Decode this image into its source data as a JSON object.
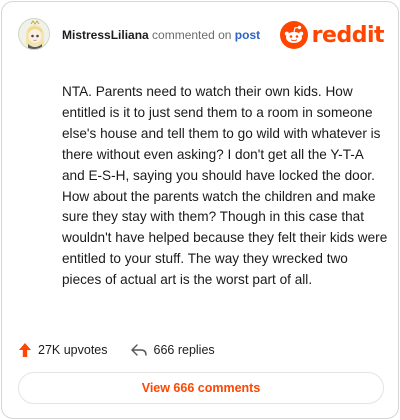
{
  "header": {
    "username": "MistressLiliana",
    "action_text": "commented on",
    "post_link": "post",
    "brand_name": "reddit",
    "icons": {
      "avatar": "anime-avatar-icon",
      "brand": "reddit-snoo-icon"
    }
  },
  "comment": {
    "body": "NTA. Parents need to watch their own kids. How entitled is it to just send them to a room in someone else's house and tell them to go wild with whatever is there without even asking? I don't get all the Y-T-A and E-S-H, saying you should have locked the door. How about the parents watch the children and make sure they stay with them? Though in this case that wouldn't have helped because they felt their kids were entitled to your stuff. The way they wrecked two pieces of actual art is the worst part of all."
  },
  "stats": {
    "upvotes": "27K upvotes",
    "replies": "666 replies",
    "icons": {
      "upvote": "upvote-arrow-icon",
      "reply": "reply-arrow-icon"
    }
  },
  "footer": {
    "view_comments_label": "View 666 comments"
  },
  "colors": {
    "brand": "#ff4500",
    "link": "#2a64c8",
    "text": "#1a1a1a",
    "muted": "#6b6b6b",
    "border": "#d6d6d6"
  }
}
